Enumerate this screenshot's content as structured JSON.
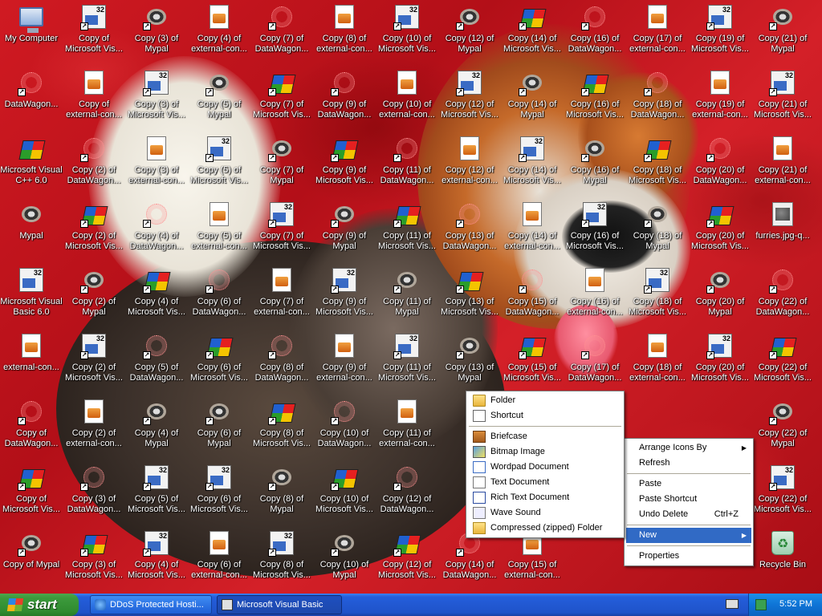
{
  "desktop": {
    "icons": [
      {
        "label": "My Computer",
        "icon": "my-computer-icon",
        "shortcut": false
      },
      {
        "label": "Copy of\nMicrosoft Vis...",
        "icon": "vb32-icon",
        "shortcut": true
      },
      {
        "label": "Copy (3) of\nMypal",
        "icon": "mypal-icon",
        "shortcut": true
      },
      {
        "label": "Copy (4) of\nexternal-con...",
        "icon": "document-icon",
        "shortcut": false
      },
      {
        "label": "Copy (7) of\nDataWagon...",
        "icon": "spider-icon",
        "shortcut": true
      },
      {
        "label": "Copy (8) of\nexternal-con...",
        "icon": "document-icon",
        "shortcut": false
      },
      {
        "label": "Copy (10) of\nMicrosoft Vis...",
        "icon": "vb32-icon",
        "shortcut": true
      },
      {
        "label": "Copy (12) of\nMypal",
        "icon": "mypal-icon",
        "shortcut": true
      },
      {
        "label": "Copy (14) of\nMicrosoft Vis...",
        "icon": "visual-cpp-icon",
        "shortcut": true
      },
      {
        "label": "Copy (16) of\nDataWagon...",
        "icon": "spider-icon",
        "shortcut": true
      },
      {
        "label": "Copy (17) of\nexternal-con...",
        "icon": "document-icon",
        "shortcut": false
      },
      {
        "label": "Copy (19) of\nMicrosoft Vis...",
        "icon": "vb32-icon",
        "shortcut": true
      },
      {
        "label": "Copy (21) of\nMypal",
        "icon": "mypal-icon",
        "shortcut": true
      },
      {
        "label": "DataWagon...",
        "icon": "spider-icon",
        "shortcut": true
      },
      {
        "label": "Copy of\nexternal-con...",
        "icon": "document-icon",
        "shortcut": false
      },
      {
        "label": "Copy (3) of\nMicrosoft Vis...",
        "icon": "vb32-icon",
        "shortcut": true
      },
      {
        "label": "Copy (5) of\nMypal",
        "icon": "mypal-icon",
        "shortcut": true
      },
      {
        "label": "Copy (7) of\nMicrosoft Vis...",
        "icon": "visual-cpp-icon",
        "shortcut": true
      },
      {
        "label": "Copy (9) of\nDataWagon...",
        "icon": "spider-icon",
        "shortcut": true
      },
      {
        "label": "Copy (10) of\nexternal-con...",
        "icon": "document-icon",
        "shortcut": false
      },
      {
        "label": "Copy (12) of\nMicrosoft Vis...",
        "icon": "vb32-icon",
        "shortcut": true
      },
      {
        "label": "Copy (14) of\nMypal",
        "icon": "mypal-icon",
        "shortcut": true
      },
      {
        "label": "Copy (16) of\nMicrosoft Vis...",
        "icon": "visual-cpp-icon",
        "shortcut": true
      },
      {
        "label": "Copy (18) of\nDataWagon...",
        "icon": "spider-icon",
        "shortcut": true
      },
      {
        "label": "Copy (19) of\nexternal-con...",
        "icon": "document-icon",
        "shortcut": false
      },
      {
        "label": "Copy (21) of\nMicrosoft Vis...",
        "icon": "vb32-icon",
        "shortcut": true
      },
      {
        "label": "Microsoft Visual\nC++ 6.0",
        "icon": "visual-cpp-icon",
        "shortcut": false
      },
      {
        "label": "Copy (2) of\nDataWagon...",
        "icon": "spider-icon",
        "shortcut": true
      },
      {
        "label": "Copy (3) of\nexternal-con...",
        "icon": "document-icon",
        "shortcut": false
      },
      {
        "label": "Copy (5) of\nMicrosoft Vis...",
        "icon": "vb32-icon",
        "shortcut": true
      },
      {
        "label": "Copy (7) of\nMypal",
        "icon": "mypal-icon",
        "shortcut": true
      },
      {
        "label": "Copy (9) of\nMicrosoft Vis...",
        "icon": "visual-cpp-icon",
        "shortcut": true
      },
      {
        "label": "Copy (11) of\nDataWagon...",
        "icon": "spider-icon",
        "shortcut": true
      },
      {
        "label": "Copy (12) of\nexternal-con...",
        "icon": "document-icon",
        "shortcut": false
      },
      {
        "label": "Copy (14) of\nMicrosoft Vis...",
        "icon": "vb32-icon",
        "shortcut": true
      },
      {
        "label": "Copy (16) of\nMypal",
        "icon": "mypal-icon",
        "shortcut": true
      },
      {
        "label": "Copy (18) of\nMicrosoft Vis...",
        "icon": "visual-cpp-icon",
        "shortcut": true
      },
      {
        "label": "Copy (20) of\nDataWagon...",
        "icon": "spider-icon",
        "shortcut": true
      },
      {
        "label": "Copy (21) of\nexternal-con...",
        "icon": "document-icon",
        "shortcut": false
      },
      {
        "label": "Mypal",
        "icon": "mypal-icon",
        "shortcut": false
      },
      {
        "label": "Copy (2) of\nMicrosoft Vis...",
        "icon": "visual-cpp-icon",
        "shortcut": true
      },
      {
        "label": "Copy (4) of\nDataWagon...",
        "icon": "spider-icon",
        "shortcut": true
      },
      {
        "label": "Copy (5) of\nexternal-con...",
        "icon": "document-icon",
        "shortcut": false
      },
      {
        "label": "Copy (7) of\nMicrosoft Vis...",
        "icon": "vb32-icon",
        "shortcut": true
      },
      {
        "label": "Copy (9) of\nMypal",
        "icon": "mypal-icon",
        "shortcut": true
      },
      {
        "label": "Copy (11) of\nMicrosoft Vis...",
        "icon": "visual-cpp-icon",
        "shortcut": true
      },
      {
        "label": "Copy (13) of\nDataWagon...",
        "icon": "spider-icon",
        "shortcut": true
      },
      {
        "label": "Copy (14) of\nexternal-con...",
        "icon": "document-icon",
        "shortcut": false
      },
      {
        "label": "Copy (16) of\nMicrosoft Vis...",
        "icon": "vb32-icon",
        "shortcut": true
      },
      {
        "label": "Copy (18) of\nMypal",
        "icon": "mypal-icon",
        "shortcut": true
      },
      {
        "label": "Copy (20) of\nMicrosoft Vis...",
        "icon": "visual-cpp-icon",
        "shortcut": true
      },
      {
        "label": "furries.jpg-q...",
        "icon": "jpg-file-icon",
        "shortcut": false
      },
      {
        "label": "Microsoft Visual\nBasic 6.0",
        "icon": "vb32-icon",
        "shortcut": false
      },
      {
        "label": "Copy (2) of\nMypal",
        "icon": "mypal-icon",
        "shortcut": true
      },
      {
        "label": "Copy (4) of\nMicrosoft Vis...",
        "icon": "visual-cpp-icon",
        "shortcut": true
      },
      {
        "label": "Copy (6) of\nDataWagon...",
        "icon": "spider-icon",
        "shortcut": true
      },
      {
        "label": "Copy (7) of\nexternal-con...",
        "icon": "document-icon",
        "shortcut": false
      },
      {
        "label": "Copy (9) of\nMicrosoft Vis...",
        "icon": "vb32-icon",
        "shortcut": true
      },
      {
        "label": "Copy (11) of\nMypal",
        "icon": "mypal-icon",
        "shortcut": true
      },
      {
        "label": "Copy (13) of\nMicrosoft Vis...",
        "icon": "visual-cpp-icon",
        "shortcut": true
      },
      {
        "label": "Copy (15) of\nDataWagon...",
        "icon": "spider-icon",
        "shortcut": true
      },
      {
        "label": "Copy (16) of\nexternal-con...",
        "icon": "document-icon",
        "shortcut": false
      },
      {
        "label": "Copy (18) of\nMicrosoft Vis...",
        "icon": "vb32-icon",
        "shortcut": true
      },
      {
        "label": "Copy (20) of\nMypal",
        "icon": "mypal-icon",
        "shortcut": true
      },
      {
        "label": "Copy (22) of\nDataWagon...",
        "icon": "spider-icon",
        "shortcut": true
      },
      {
        "label": "external-con...",
        "icon": "document-icon",
        "shortcut": false
      },
      {
        "label": "Copy (2) of\nMicrosoft Vis...",
        "icon": "vb32-icon",
        "shortcut": true
      },
      {
        "label": "Copy (5) of\nDataWagon...",
        "icon": "spider-icon",
        "shortcut": true
      },
      {
        "label": "Copy (6) of\nMicrosoft Vis...",
        "icon": "visual-cpp-icon",
        "shortcut": true
      },
      {
        "label": "Copy (8) of\nDataWagon...",
        "icon": "spider-icon",
        "shortcut": true
      },
      {
        "label": "Copy (9) of\nexternal-con...",
        "icon": "document-icon",
        "shortcut": false
      },
      {
        "label": "Copy (11) of\nMicrosoft Vis...",
        "icon": "vb32-icon",
        "shortcut": true
      },
      {
        "label": "Copy (13) of\nMypal",
        "icon": "mypal-icon",
        "shortcut": true
      },
      {
        "label": "Copy (15) of\nMicrosoft Vis...",
        "icon": "visual-cpp-icon",
        "shortcut": true
      },
      {
        "label": "Copy (17) of\nDataWagon...",
        "icon": "spider-icon",
        "shortcut": true
      },
      {
        "label": "Copy (18) of\nexternal-con...",
        "icon": "document-icon",
        "shortcut": false
      },
      {
        "label": "Copy (20) of\nMicrosoft Vis...",
        "icon": "vb32-icon",
        "shortcut": true
      },
      {
        "label": "Copy (22) of\nMicrosoft Vis...",
        "icon": "visual-cpp-icon",
        "shortcut": true
      },
      {
        "label": "Copy of\nDataWagon...",
        "icon": "spider-icon",
        "shortcut": true
      },
      {
        "label": "Copy (2) of\nexternal-con...",
        "icon": "document-icon",
        "shortcut": false
      },
      {
        "label": "Copy (4) of\nMypal",
        "icon": "mypal-icon",
        "shortcut": true
      },
      {
        "label": "Copy (6) of\nMypal",
        "icon": "mypal-icon",
        "shortcut": true
      },
      {
        "label": "Copy (8) of\nMicrosoft Vis...",
        "icon": "visual-cpp-icon",
        "shortcut": true
      },
      {
        "label": "Copy (10) of\nDataWagon...",
        "icon": "spider-icon",
        "shortcut": true
      },
      {
        "label": "Copy (11) of\nexternal-con...",
        "icon": "document-icon",
        "shortcut": false
      },
      {
        "label": "Copy (22) of\nMypal",
        "icon": "mypal-icon",
        "shortcut": true
      },
      {
        "label": "Copy of\nMicrosoft Vis...",
        "icon": "visual-cpp-icon",
        "shortcut": true
      },
      {
        "label": "Copy (3) of\nDataWagon...",
        "icon": "spider-icon",
        "shortcut": true
      },
      {
        "label": "Copy (5) of\nMicrosoft Vis...",
        "icon": "vb32-icon",
        "shortcut": true
      },
      {
        "label": "Copy (6) of\nMicrosoft Vis...",
        "icon": "vb32-icon",
        "shortcut": true
      },
      {
        "label": "Copy (8) of\nMypal",
        "icon": "mypal-icon",
        "shortcut": true
      },
      {
        "label": "Copy (10) of\nMicrosoft Vis...",
        "icon": "visual-cpp-icon",
        "shortcut": true
      },
      {
        "label": "Copy (12) of\nDataWagon...",
        "icon": "spider-icon",
        "shortcut": true
      },
      {
        "label": "Copy (22) of\nMicrosoft Vis...",
        "icon": "vb32-icon",
        "shortcut": true
      },
      {
        "label": "Copy of Mypal",
        "icon": "mypal-icon",
        "shortcut": true
      },
      {
        "label": "Copy (3) of\nMicrosoft Vis...",
        "icon": "visual-cpp-icon",
        "shortcut": true
      },
      {
        "label": "Copy (4) of\nMicrosoft Vis...",
        "icon": "vb32-icon",
        "shortcut": true
      },
      {
        "label": "Copy (6) of\nexternal-con...",
        "icon": "document-icon",
        "shortcut": false
      },
      {
        "label": "Copy (8) of\nMicrosoft Vis...",
        "icon": "vb32-icon",
        "shortcut": true
      },
      {
        "label": "Copy (10) of\nMypal",
        "icon": "mypal-icon",
        "shortcut": true
      },
      {
        "label": "Copy (12) of\nMicrosoft Vis...",
        "icon": "visual-cpp-icon",
        "shortcut": true
      },
      {
        "label": "Copy (14) of\nDataWagon...",
        "icon": "spider-icon",
        "shortcut": true
      },
      {
        "label": "Copy (15) of\nexternal-con...",
        "icon": "document-icon",
        "shortcut": false
      },
      {
        "label": "Recycle Bin",
        "icon": "recycle-bin-icon",
        "shortcut": false
      }
    ]
  },
  "context_menu": {
    "items": [
      {
        "label": "Arrange Icons By",
        "submenu": true
      },
      {
        "label": "Refresh"
      },
      {
        "separator": true
      },
      {
        "label": "Paste"
      },
      {
        "label": "Paste Shortcut"
      },
      {
        "label": "Undo Delete",
        "shortcut": "Ctrl+Z"
      },
      {
        "separator": true
      },
      {
        "label": "New",
        "submenu": true,
        "highlighted": true
      },
      {
        "separator": true
      },
      {
        "label": "Properties"
      }
    ]
  },
  "new_submenu": {
    "items": [
      {
        "label": "Folder",
        "icon": "folder-icon"
      },
      {
        "label": "Shortcut",
        "icon": "shortcut-icon"
      },
      {
        "separator": true
      },
      {
        "label": "Briefcase",
        "icon": "briefcase-icon"
      },
      {
        "label": "Bitmap Image",
        "icon": "bitmap-image-icon"
      },
      {
        "label": "Wordpad Document",
        "icon": "wordpad-document-icon"
      },
      {
        "label": "Text Document",
        "icon": "text-document-icon"
      },
      {
        "label": "Rich Text Document",
        "icon": "rich-text-document-icon"
      },
      {
        "label": "Wave Sound",
        "icon": "wave-sound-icon"
      },
      {
        "label": "Compressed (zipped) Folder",
        "icon": "zipped-folder-icon"
      }
    ]
  },
  "taskbar": {
    "start_label": "start",
    "tasks": [
      {
        "label": "DDoS Protected Hosti...",
        "icon": "internet-explorer-icon",
        "active": false
      },
      {
        "label": "Microsoft Visual Basic",
        "icon": "visual-basic-icon",
        "active": true
      }
    ],
    "clock": "5:52 PM"
  },
  "colors": {
    "taskbar_blue": "#245edb",
    "start_green": "#3c9a3c",
    "menu_highlight": "#316ac5",
    "wallpaper_red": "#c0141e"
  }
}
